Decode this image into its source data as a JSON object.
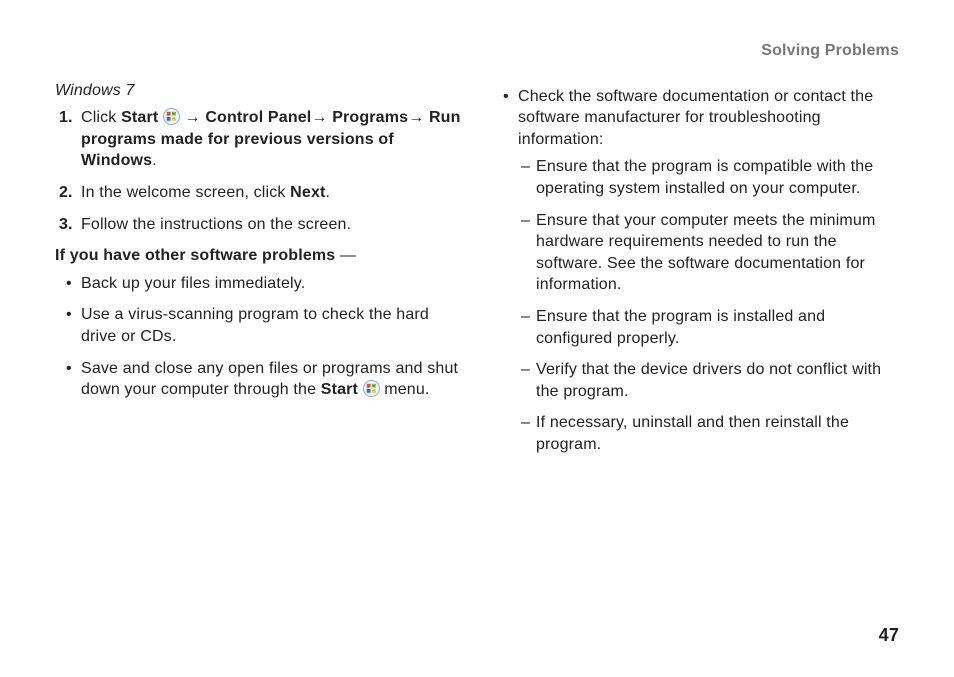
{
  "header": {
    "title": "Solving Problems"
  },
  "left": {
    "subhead": "Windows 7",
    "steps": [
      {
        "num": "1.",
        "before": "Click ",
        "b1": "Start",
        "mid1": " ",
        "icon": true,
        "mid2": " → ",
        "b2": "Control Panel",
        "mid3": "→ ",
        "b3": "Programs",
        "mid4": "→ ",
        "b4": "Run programs made for previous versions of Windows",
        "after": "."
      },
      {
        "num": "2.",
        "before": "In the welcome screen, click ",
        "b1": "Next",
        "after": "."
      },
      {
        "num": "3.",
        "before": "Follow the instructions on the screen."
      }
    ],
    "otherHeading_bold": "If you have other software problems",
    "otherHeading_tail": " —",
    "bullets": [
      {
        "text": "Back up your files immediately."
      },
      {
        "text": "Use a virus-scanning program to check the hard drive or CDs."
      },
      {
        "before": "Save and close any open files or programs and shut down your computer through the ",
        "b1": "Start",
        "mid1": " ",
        "icon": true,
        "after": " menu."
      }
    ]
  },
  "right": {
    "bullets": [
      {
        "text": "Check the software documentation or contact the software manufacturer for troubleshooting information:",
        "dashes": [
          "Ensure that the program is compatible with the operating system installed on your computer.",
          "Ensure that your computer meets the minimum hardware requirements needed to run the software. See the software documentation for information.",
          "Ensure that the program is installed and configured properly.",
          "Verify that the device drivers do not conflict with the program.",
          "If necessary, uninstall and then reinstall the program."
        ]
      }
    ]
  },
  "pageNumber": "47"
}
